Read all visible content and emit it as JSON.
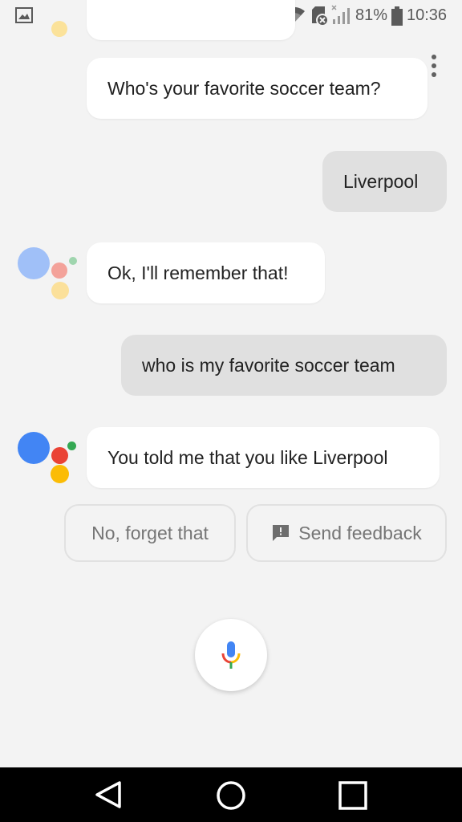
{
  "status_bar": {
    "battery_percent": "81%",
    "time": "10:36",
    "icons": [
      "gallery-icon",
      "location-icon",
      "wifi-icon",
      "sd-card-icon",
      "signal-icon",
      "battery-icon"
    ]
  },
  "conversation": {
    "assistant_question": "Who's your favorite soccer team?",
    "user_reply_1": "Liverpool",
    "assistant_ack": "Ok, I'll remember that!",
    "user_query_2": "who is my favorite soccer team",
    "assistant_answer": "You told me that you like Liverpool"
  },
  "suggestions": {
    "forget": "No, forget that",
    "feedback": "Send feedback"
  },
  "colors": {
    "google_blue": "#4285f4",
    "google_red": "#ea4335",
    "google_yellow": "#fbbc05",
    "google_green": "#34a853",
    "user_bubble": "#e0e0e0",
    "assistant_bubble": "#ffffff"
  }
}
